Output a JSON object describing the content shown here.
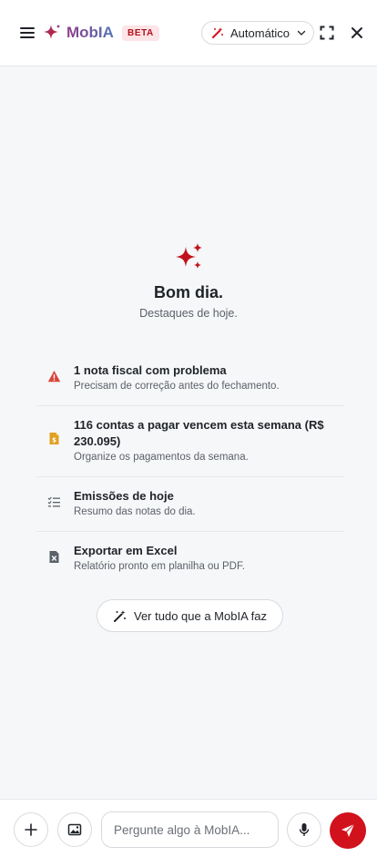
{
  "header": {
    "brand_name": "MobIA",
    "beta_badge": "BETA",
    "mode": "Automático"
  },
  "hero": {
    "greeting": "Bom dia.",
    "subtitle": "Destaques de hoje."
  },
  "highlights": [
    {
      "icon": "warning-icon",
      "title": "1 nota fiscal com problema",
      "description": "Precisam de correção antes do fechamento."
    },
    {
      "icon": "invoice-dollar-icon",
      "title": "116 contas a pagar vencem esta semana (R$ 230.095)",
      "description": "Organize os pagamentos da semana."
    },
    {
      "icon": "checklist-icon",
      "title": "Emissões de hoje",
      "description": "Resumo das notas do dia."
    },
    {
      "icon": "excel-file-icon",
      "title": "Exportar em Excel",
      "description": "Relatório pronto em planilha ou PDF."
    }
  ],
  "see_all_label": "Ver tudo que a MobIA faz",
  "composer": {
    "placeholder": "Pergunte algo à MobIA..."
  },
  "colors": {
    "brand_red": "#d1111b",
    "warning": "#d9453b",
    "invoice": "#e0a020",
    "beta_bg": "#fde4e6"
  }
}
